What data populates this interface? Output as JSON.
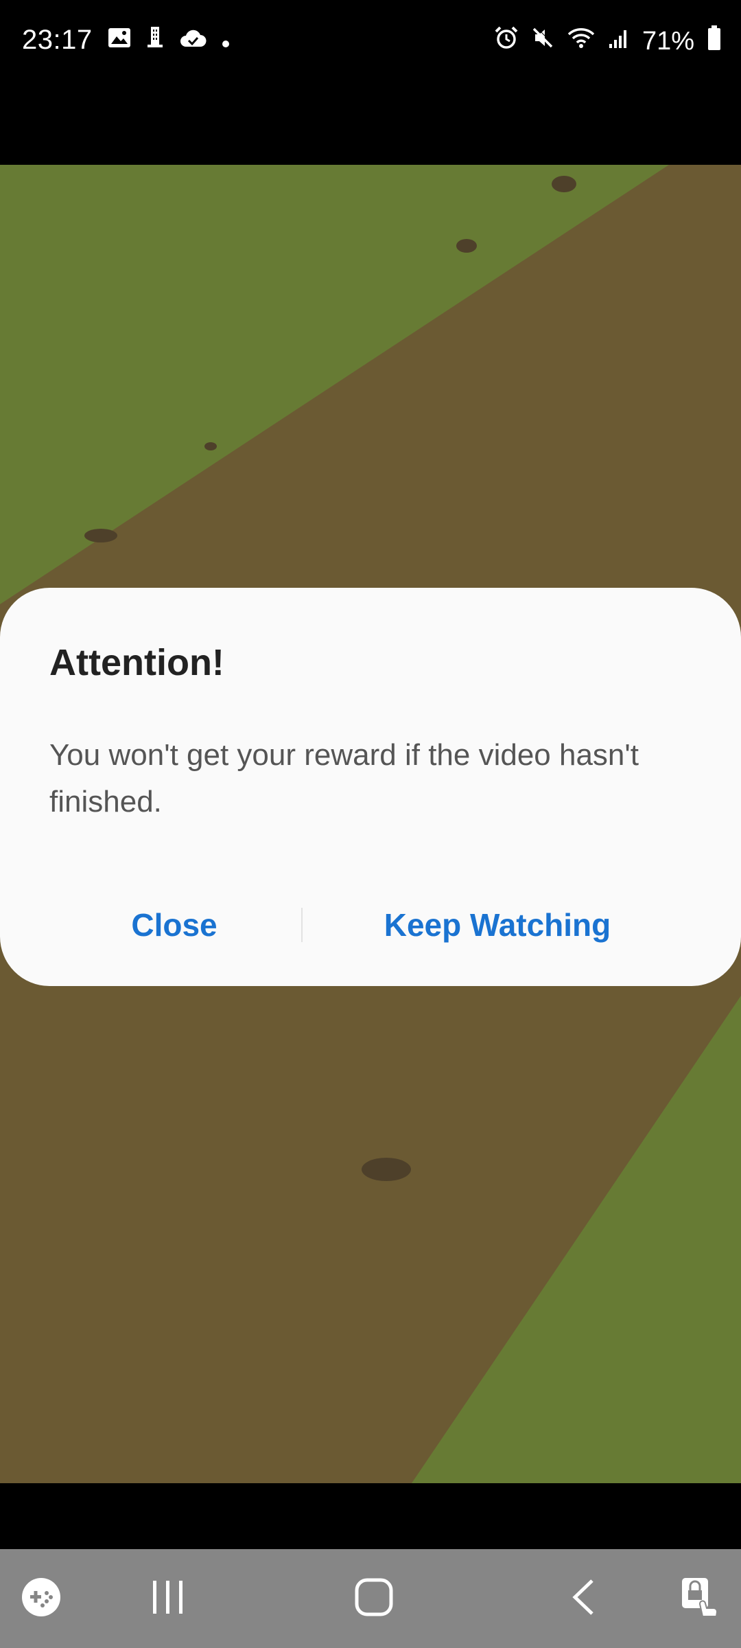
{
  "status_bar": {
    "time": "23:17",
    "battery": "71%",
    "left_icons": [
      "image-icon",
      "building-icon",
      "cloud-check-icon",
      "dot-icon"
    ],
    "right_icons": [
      "alarm-icon",
      "mute-icon",
      "wifi-icon",
      "signal-icon",
      "battery-icon"
    ]
  },
  "dialog": {
    "title": "Attention!",
    "message": "You won't get your reward if the video hasn't finished.",
    "close_label": "Close",
    "keep_watching_label": "Keep Watching"
  },
  "nav_bar": {
    "items": [
      "game-tools-icon",
      "recent-apps-icon",
      "home-icon",
      "back-icon",
      "lock-touch-icon"
    ]
  },
  "colors": {
    "accent": "#1a73d1",
    "grass": "#677b34",
    "dirt": "#6b5a33",
    "nav_bar": "#868686"
  }
}
